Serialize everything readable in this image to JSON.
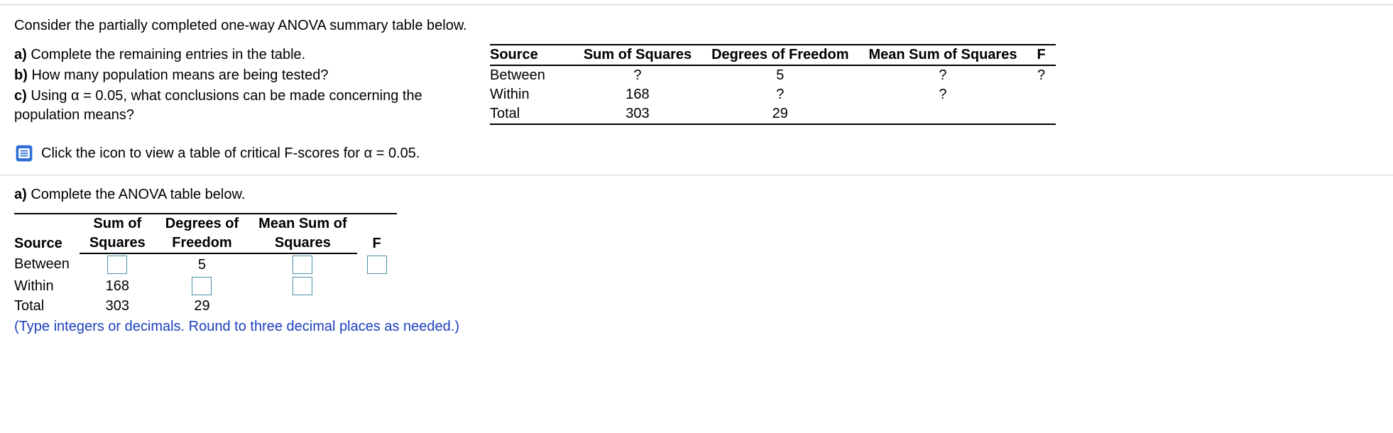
{
  "intro": "Consider the partially completed one-way ANOVA summary table below.",
  "parts": {
    "a_label": "a)",
    "a_text": " Complete the remaining entries in the table.",
    "b_label": "b)",
    "b_text": " How many population means are being tested?",
    "c_label": "c)",
    "c_text_1": " Using ",
    "c_alpha": "α = 0.05",
    "c_text_2": ", what conclusions can be made concerning the population means?"
  },
  "ref_table": {
    "headers": [
      "Source",
      "Sum of Squares",
      "Degrees of Freedom",
      "Mean Sum of Squares",
      "F"
    ],
    "rows": [
      {
        "source": "Between",
        "ss": "?",
        "df": "5",
        "ms": "?",
        "f": "?"
      },
      {
        "source": "Within",
        "ss": "168",
        "df": "?",
        "ms": "?",
        "f": ""
      },
      {
        "source": "Total",
        "ss": "303",
        "df": "29",
        "ms": "",
        "f": ""
      }
    ]
  },
  "icon_link_text": "Click the icon to view a table of critical F-scores for α = 0.05.",
  "answer": {
    "prompt_label": "a)",
    "prompt_text": " Complete the ANOVA table below.",
    "headers": {
      "source": "Source",
      "ss1": "Sum of",
      "ss2": "Squares",
      "df1": "Degrees of",
      "df2": "Freedom",
      "ms1": "Mean Sum of",
      "ms2": "Squares",
      "f": "F"
    },
    "rows": {
      "between": {
        "source": "Between",
        "df": "5"
      },
      "within": {
        "source": "Within",
        "ss": "168"
      },
      "total": {
        "source": "Total",
        "ss": "303",
        "df": "29"
      }
    },
    "hint": "(Type integers or decimals. Round to three decimal places as needed.)"
  }
}
